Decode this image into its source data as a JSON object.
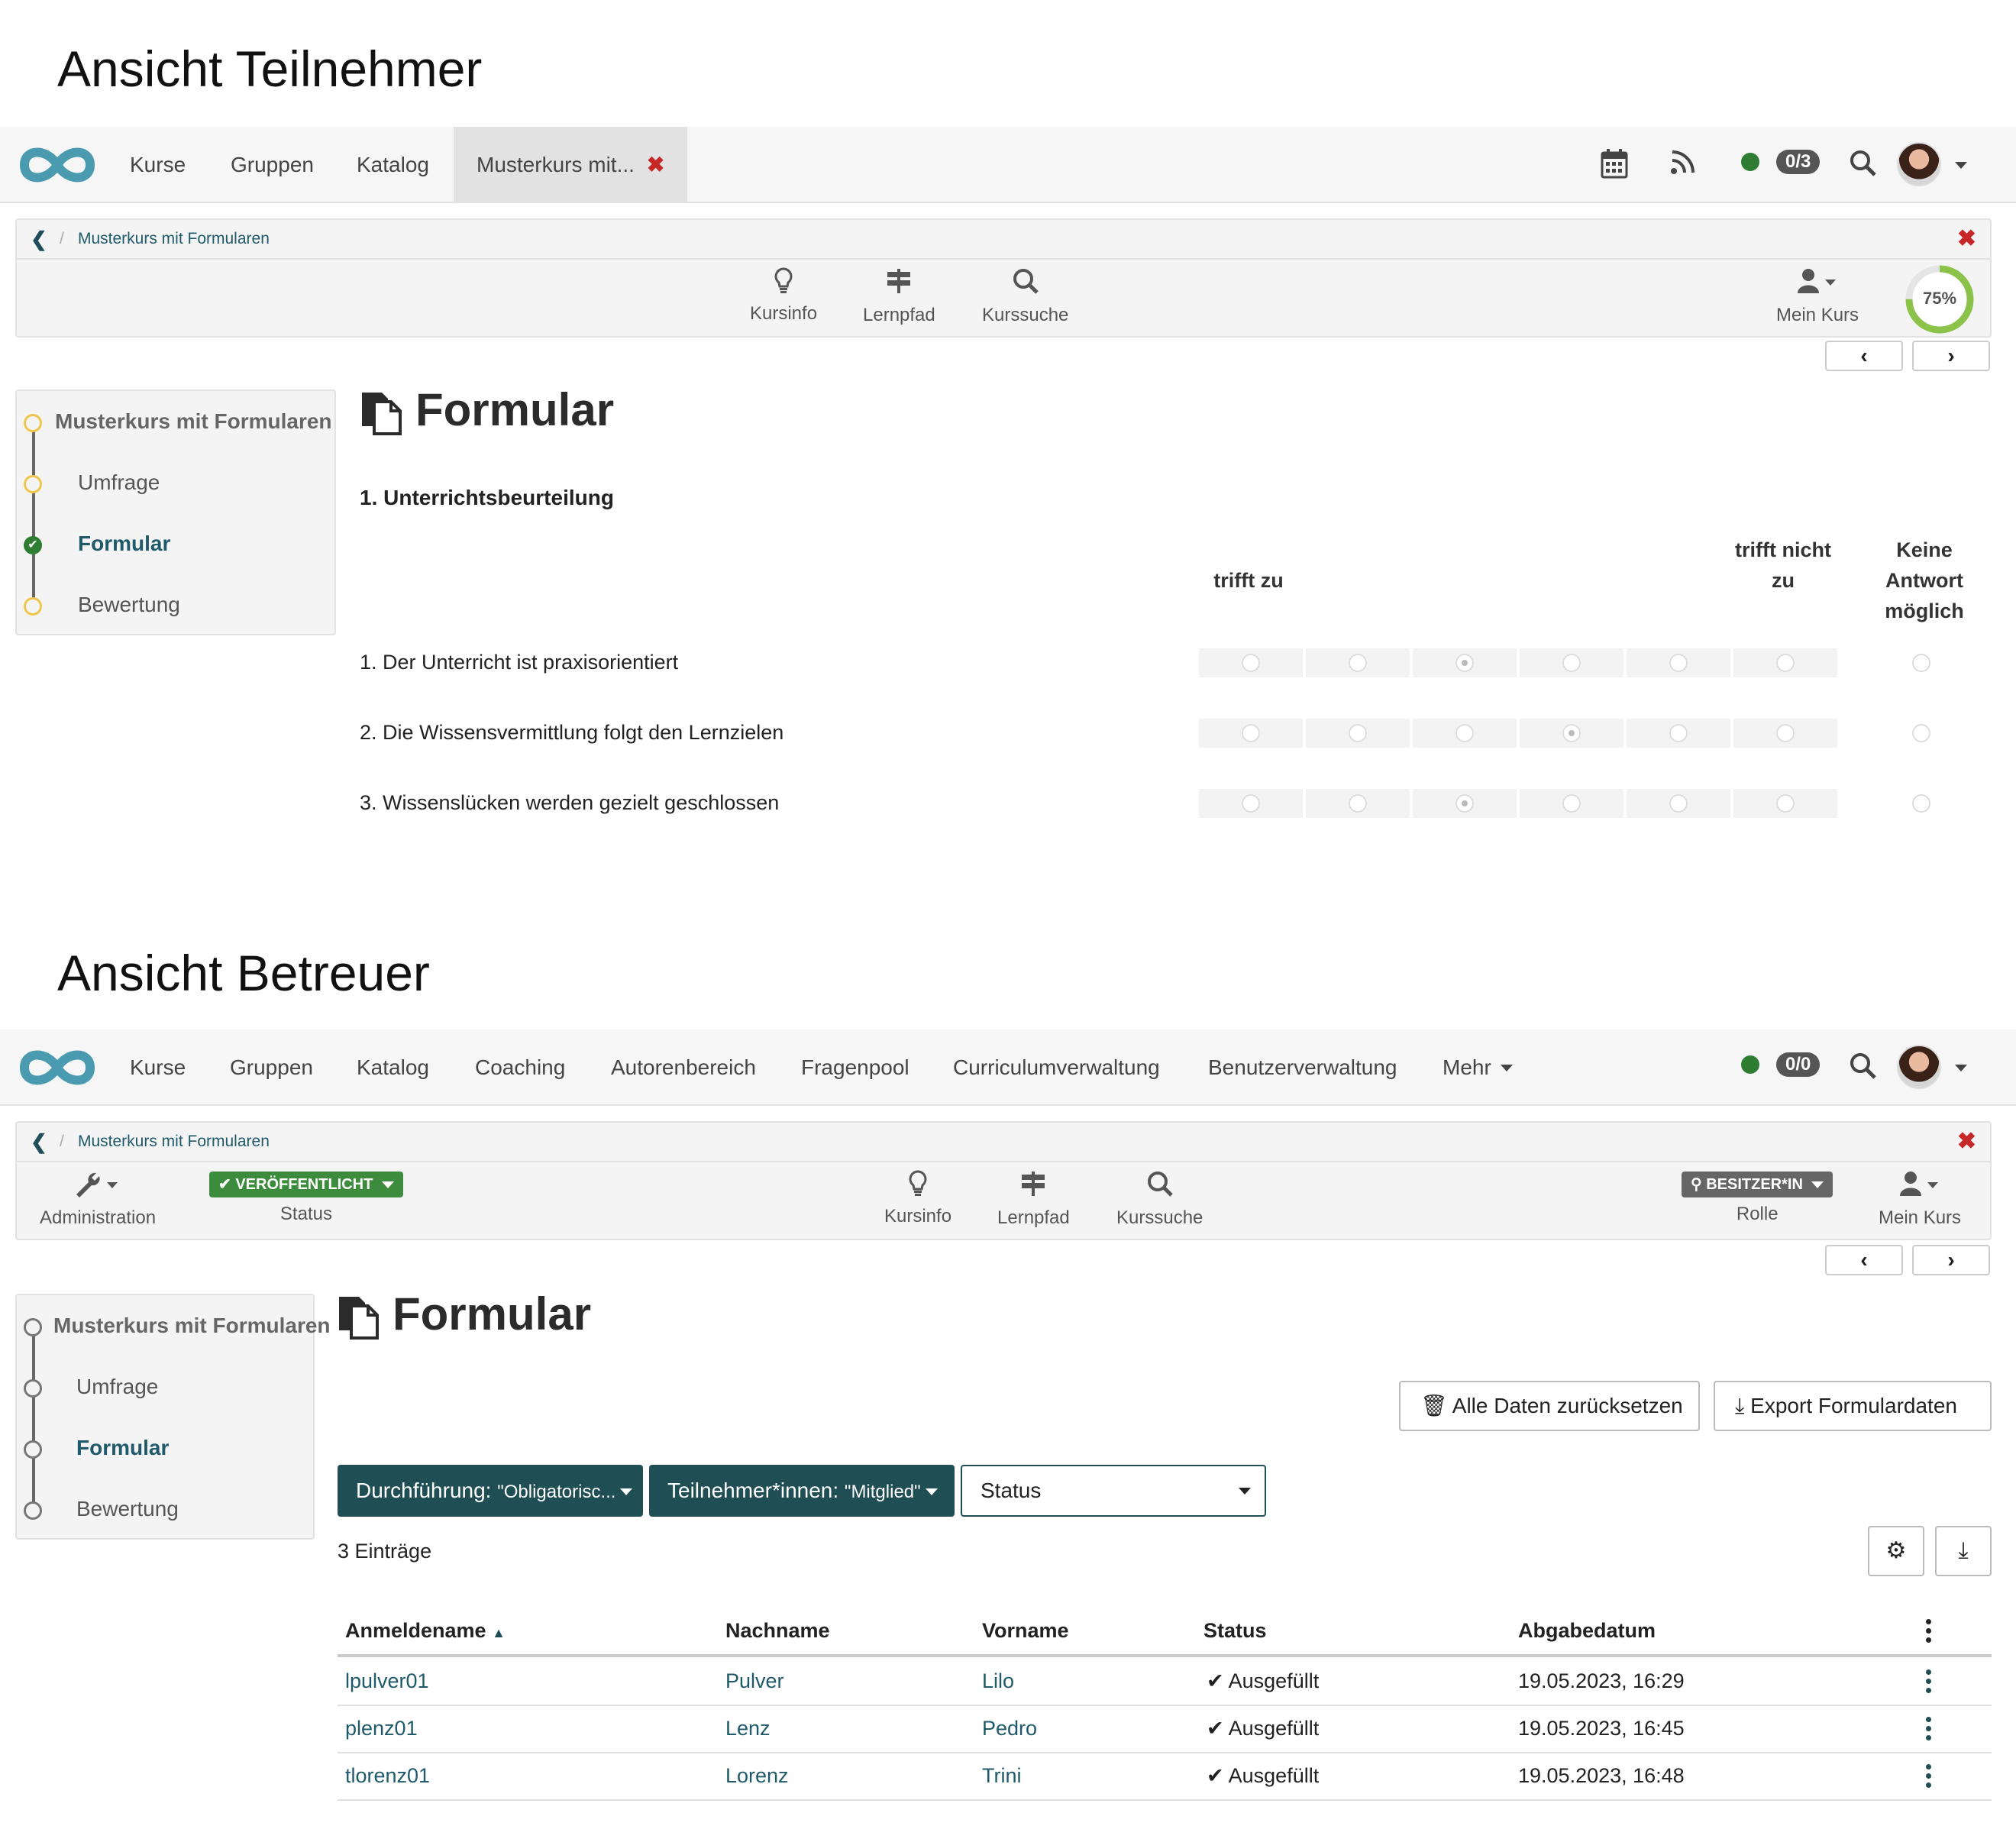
{
  "participant_view": {
    "section_title": "Ansicht Teilnehmer",
    "nav": {
      "items": [
        "Kurse",
        "Gruppen",
        "Katalog"
      ],
      "active_tab": "Musterkurs mit...",
      "counter": "0/3"
    },
    "breadcrumb": "Musterkurs mit Formularen",
    "tools": {
      "kursinfo": "Kursinfo",
      "lernpfad": "Lernpfad",
      "kurssuche": "Kurssuche",
      "mein_kurs": "Mein Kurs"
    },
    "progress": {
      "value": 0.75,
      "label": "75%"
    },
    "menu": {
      "root": "Musterkurs mit Formularen",
      "items": [
        "Umfrage",
        "Formular",
        "Bewertung"
      ]
    },
    "page_title": "Formular",
    "form": {
      "section": "1. Unterrichtsbeurteilung",
      "col_left": "trifft zu",
      "col_right_1": "trifft nicht",
      "col_right_2": "zu",
      "col_na_1": "Keine",
      "col_na_2": "Antwort",
      "col_na_3": "möglich",
      "questions": [
        {
          "text": "1. Der Unterricht ist praxisorientiert",
          "selected": 3
        },
        {
          "text": "2. Die Wissensvermittlung folgt den Lernzielen",
          "selected": 4
        },
        {
          "text": "3. Wissenslücken werden gezielt geschlossen",
          "selected": 3
        }
      ]
    }
  },
  "coach_view": {
    "section_title": "Ansicht Betreuer",
    "nav": {
      "items": [
        "Kurse",
        "Gruppen",
        "Katalog",
        "Coaching",
        "Autorenbereich",
        "Fragenpool",
        "Curriculumverwaltung",
        "Benutzerverwaltung"
      ],
      "more": "Mehr",
      "counter": "0/0"
    },
    "breadcrumb": "Musterkurs mit Formularen",
    "tools": {
      "administration": "Administration",
      "status_badge": "VERÖFFENTLICHT",
      "status": "Status",
      "kursinfo": "Kursinfo",
      "lernpfad": "Lernpfad",
      "kurssuche": "Kurssuche",
      "role_badge": "BESITZER*IN",
      "rolle": "Rolle",
      "mein_kurs": "Mein Kurs"
    },
    "menu": {
      "root": "Musterkurs mit Formularen",
      "items": [
        "Umfrage",
        "Formular",
        "Bewertung"
      ]
    },
    "page_title": "Formular",
    "buttons": {
      "reset": "Alle Daten zurücksetzen",
      "export": "Export Formulardaten"
    },
    "filters": {
      "f1_label": "Durchführung:",
      "f1_value": "\"Obligatorisc...",
      "f2_label": "Teilnehmer*innen:",
      "f2_value": "\"Mitglied\"",
      "status": "Status"
    },
    "entries": "3 Einträge",
    "table": {
      "headers": [
        "Anmeldename",
        "Nachname",
        "Vorname",
        "Status",
        "Abgabedatum"
      ],
      "rows": [
        {
          "login": "lpulver01",
          "last": "Pulver",
          "first": "Lilo",
          "status": "Ausgefüllt",
          "date": "19.05.2023, 16:29"
        },
        {
          "login": "plenz01",
          "last": "Lenz",
          "first": "Pedro",
          "status": "Ausgefüllt",
          "date": "19.05.2023, 16:45"
        },
        {
          "login": "tlorenz01",
          "last": "Lorenz",
          "first": "Trini",
          "status": "Ausgefüllt",
          "date": "19.05.2023, 16:48"
        }
      ]
    }
  },
  "colors": {
    "accent": "#1f4e55",
    "logo": "#4a9bb0",
    "published": "#3d8b3d",
    "close": "#c62828",
    "progress": "#8bc34a"
  }
}
